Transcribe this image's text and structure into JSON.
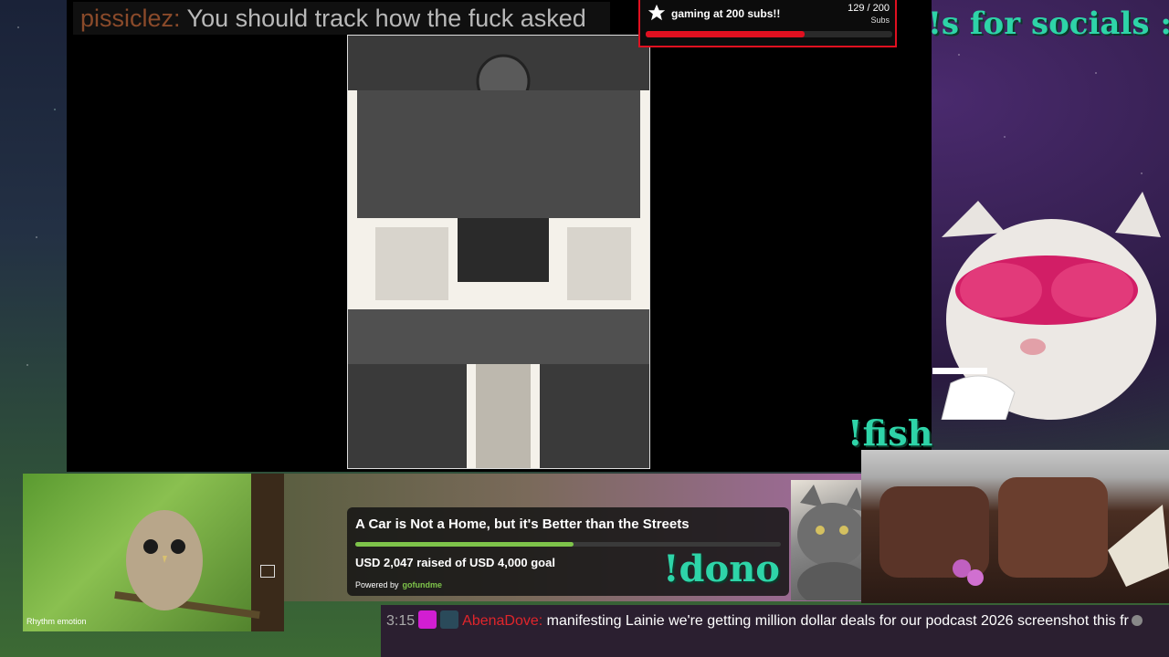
{
  "chat_overlay_top": {
    "username": "pissiclez:",
    "message": "You should track how the fuck asked"
  },
  "sub_goal": {
    "title": "gaming at 200 subs!!",
    "current": 129,
    "goal": 200,
    "count_text": "129 / 200",
    "unit_label": "Subs",
    "progress_fraction": 0.645,
    "accent_color": "#e01020"
  },
  "socials_text": "!s for socials :)",
  "fish_command": "!fish",
  "dono_command": "!dono",
  "owl_cam": {
    "brand_label": "Rhythm emotion"
  },
  "fundraiser": {
    "title": "A Car is Not a Home, but it's Better than the Streets",
    "raised_text": "USD 2,047 raised of USD 4,000 goal",
    "raised": 2047,
    "goal": 4000,
    "progress_fraction": 0.512,
    "powered_by": "Powered by",
    "platform": "gofundme",
    "accent_color": "#7ec44a"
  },
  "chat_bottom": {
    "timestamp": "3:15",
    "badges": [
      "heart-badge-icon",
      "cat-emote-badge-icon"
    ],
    "username": "AbenaDove:",
    "message": "manifesting Lainie we're getting million dollar deals for our podcast 2026 screenshot this fr"
  },
  "colors": {
    "command_text": "#2ed4a8",
    "chat_username": "#e0252b",
    "chat_bg": "#2b1f30"
  }
}
